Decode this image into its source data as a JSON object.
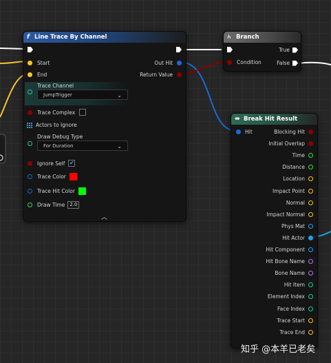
{
  "line_trace": {
    "title": "Line Trace By Channel",
    "title_icon": "f",
    "start_label": "Start",
    "end_label": "End",
    "out_hit_label": "Out Hit",
    "return_value_label": "Return Value",
    "trace_channel_label": "Trace Channel",
    "trace_channel_value": "JumpTrigger",
    "trace_complex_label": "Trace Complex",
    "actors_to_ignore_label": "Actors to Ignore",
    "draw_debug_type_label": "Draw Debug Type",
    "draw_debug_type_value": "For Duration",
    "ignore_self_label": "Ignore Self",
    "ignore_self_check": "✔",
    "trace_color_label": "Trace Color",
    "trace_hit_color_label": "Trace Hit Color",
    "draw_time_label": "Draw Time",
    "draw_time_value": "2.0",
    "expand_icon": "︿"
  },
  "branch": {
    "title": "Branch",
    "condition_label": "Condition",
    "true_label": "True",
    "false_label": "False"
  },
  "break_hit": {
    "title": "Break Hit Result",
    "hit_label": "Hit",
    "outputs": [
      "Blocking Hit",
      "Initial Overlap",
      "Time",
      "Distance",
      "Location",
      "Impact Point",
      "Normal",
      "Impact Normal",
      "Phys Mat",
      "Hit Actor",
      "Hit Component",
      "Hit Bone Name",
      "Bone Name",
      "Hit Item",
      "Element Index",
      "Face Index",
      "Trace Start",
      "Trace End"
    ]
  },
  "colors": {
    "exec": "#ffffff",
    "vector": "#f7c52b",
    "struct": "#1a6ad6",
    "bool": "#8c0000",
    "float": "#3fd84a",
    "object": "#1fa0e8",
    "name": "#b07ce8",
    "int": "#21c99b",
    "trace_color": "#ff0000",
    "trace_hit_color": "#00ff00"
  },
  "watermark": "知乎 @本羊已老矣"
}
